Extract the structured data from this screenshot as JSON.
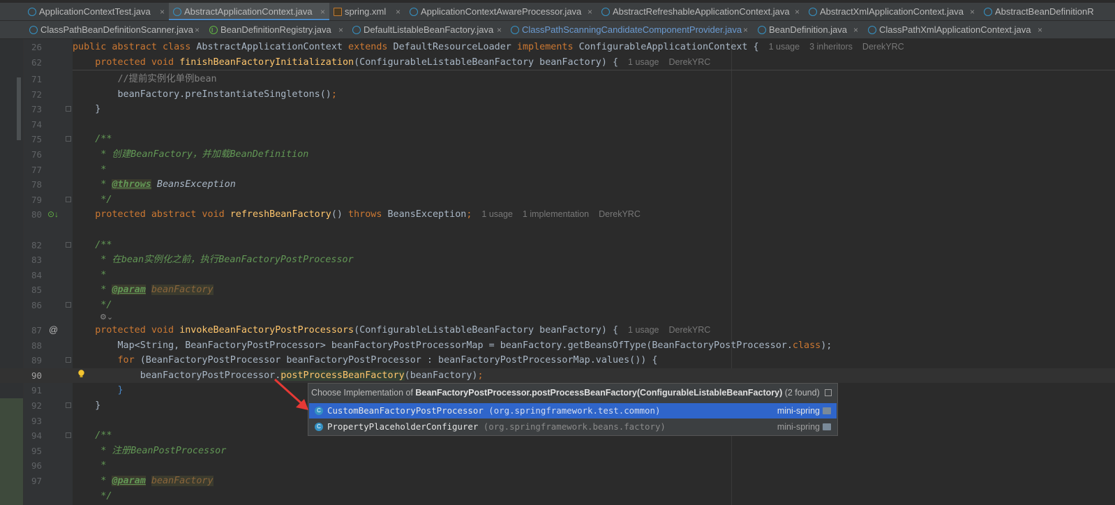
{
  "tabs_row1": [
    {
      "label": "ApplicationContextTest.java",
      "icon": "class-icon"
    },
    {
      "label": "AbstractApplicationContext.java",
      "icon": "class-icon",
      "active": true
    },
    {
      "label": "spring.xml",
      "icon": "xml-icon"
    },
    {
      "label": "ApplicationContextAwareProcessor.java",
      "icon": "class-icon"
    },
    {
      "label": "AbstractRefreshableApplicationContext.java",
      "icon": "abstract-class-icon"
    },
    {
      "label": "AbstractXmlApplicationContext.java",
      "icon": "abstract-class-icon"
    },
    {
      "label": "AbstractBeanDefinitionR",
      "icon": "abstract-class-icon"
    }
  ],
  "tabs_row2": [
    {
      "label": "ClassPathBeanDefinitionScanner.java",
      "icon": "class-icon"
    },
    {
      "label": "BeanDefinitionRegistry.java",
      "icon": "interface-icon"
    },
    {
      "label": "DefaultListableBeanFactory.java",
      "icon": "class-icon"
    },
    {
      "label": "ClassPathScanningCandidateComponentProvider.java",
      "icon": "class-icon",
      "modified": true
    },
    {
      "label": "BeanDefinition.java",
      "icon": "class-icon"
    },
    {
      "label": "ClassPathXmlApplicationContext.java",
      "icon": "class-icon"
    }
  ],
  "close_glyph": "×",
  "lines": {
    "l26": "26",
    "l62": "62",
    "l71": "71",
    "l72": "72",
    "l73": "73",
    "l74": "74",
    "l75": "75",
    "l76": "76",
    "l77": "77",
    "l78": "78",
    "l79": "79",
    "l80": "80",
    "l82": "82",
    "l83": "83",
    "l84": "84",
    "l85": "85",
    "l86": "86",
    "l87": "87",
    "l88": "88",
    "l89": "89",
    "l90": "90",
    "l91": "91",
    "l92": "92",
    "l93": "93",
    "l94": "94",
    "l95": "95",
    "l96": "96",
    "l97": "97"
  },
  "code": {
    "c26_a": "public abstract class ",
    "c26_b": "AbstractApplicationContext ",
    "c26_c": "extends ",
    "c26_d": "DefaultResourceLoader ",
    "c26_e": "implements ",
    "c26_f": "ConfigurableApplicationContext {",
    "h26_1": "1 usage",
    "h26_2": "3 inheritors",
    "h26_3": "DerekYRC",
    "c62_a": "    protected void ",
    "c62_b": "finishBeanFactoryInitialization",
    "c62_c": "(ConfigurableListableBeanFactory beanFactory) {",
    "h62_1": "1 usage",
    "h62_2": "DerekYRC",
    "c71": "        //提前实例化单例bean",
    "c72_a": "        beanFactory.preInstantiateSingletons()",
    "c72_b": ";",
    "c73": "    }",
    "c75": "    /**",
    "c76": "     * 创建BeanFactory，并加载BeanDefinition",
    "c77": "     *",
    "c78_a": "     * ",
    "c78_b": "@throws",
    "c78_c": " BeansException",
    "c79": "     */",
    "c80_a": "    protected abstract void ",
    "c80_b": "refreshBeanFactory",
    "c80_c": "() ",
    "c80_d": "throws ",
    "c80_e": "BeansException",
    "c80_f": ";",
    "h80_1": "1 usage",
    "h80_2": "1 implementation",
    "h80_3": "DerekYRC",
    "c82": "    /**",
    "c83": "     * 在bean实例化之前，执行BeanFactoryPostProcessor",
    "c84": "     *",
    "c85_a": "     * ",
    "c85_b": "@param",
    "c85_c": "beanFactory",
    "c86": "     */",
    "lens": "⚙⌄",
    "c87_a": "    protected void ",
    "c87_b": "invokeBeanFactoryPostProcessors",
    "c87_c": "(ConfigurableListableBeanFactory beanFactory) {",
    "h87_1": "1 usage",
    "h87_2": "DerekYRC",
    "c88_a": "        Map<String, BeanFactoryPostProcessor> beanFactoryPostProcessorMap = beanFactory.getBeansOfType(BeanFactoryPostProcessor.",
    "c88_b": "class",
    "c88_c": ");",
    "c89_a": "        ",
    "c89_b": "for ",
    "c89_c": "(BeanFactoryPostProcessor beanFactoryPostProcessor : beanFactoryPostProcessorMap.values()) {",
    "c90_a": "            beanFactoryPostProcessor.",
    "c90_b": "postProcessBeanFactory",
    "c90_c": "(beanFactory)",
    "c90_d": ";",
    "c91": "        }",
    "c92": "    }",
    "c94": "    /**",
    "c95": "     * 注册BeanPostProcessor",
    "c96": "     *",
    "c97_a": "     * ",
    "c97_b": "@param",
    "c97_c": "beanFactory",
    "c98": "     */"
  },
  "popup": {
    "title_prefix": "Choose Implementation of ",
    "title_bold": "BeanFactoryPostProcessor.postProcessBeanFactory(ConfigurableListableBeanFactory)",
    "title_suffix": " (2 found)",
    "items": [
      {
        "name": "CustomBeanFactoryPostProcessor",
        "pkg": " (org.springframework.test.common)",
        "module": "mini-spring",
        "selected": true
      },
      {
        "name": "PropertyPlaceholderConfigurer",
        "pkg": " (org.springframework.beans.factory)",
        "module": "mini-spring",
        "selected": false
      }
    ]
  },
  "colors": {
    "accent": "#4a88c7",
    "selection": "#2f65ca",
    "keyword": "#cc7832",
    "method": "#ffc66d",
    "comment": "#629755",
    "arrow": "#e53935"
  }
}
